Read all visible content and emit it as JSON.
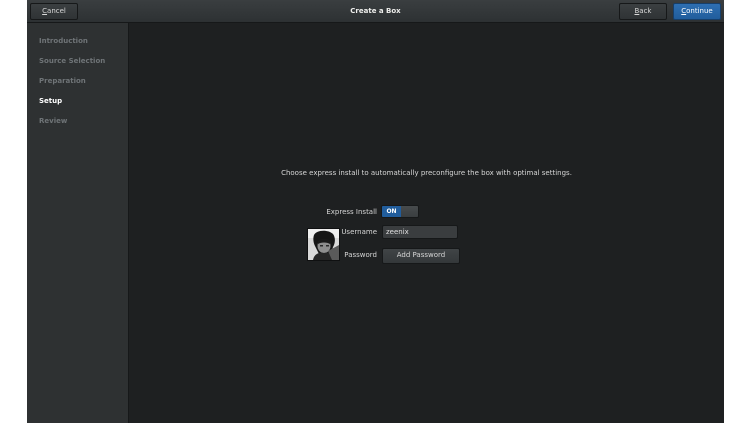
{
  "header": {
    "cancel_prefix": "C",
    "cancel_rest": "ancel",
    "title": "Create a Box",
    "back_prefix": "B",
    "back_rest": "ack",
    "continue_prefix": "C",
    "continue_rest": "ontinue"
  },
  "sidebar": {
    "steps": [
      {
        "label": "Introduction"
      },
      {
        "label": "Source Selection"
      },
      {
        "label": "Preparation"
      },
      {
        "label": "Setup",
        "active": true
      },
      {
        "label": "Review"
      }
    ]
  },
  "setup": {
    "hint": "Choose express install to automatically preconfigure the box with optimal settings.",
    "express_label": "Express Install",
    "express_state": "ON",
    "username_label": "Username",
    "username_value": "zeenix",
    "password_label": "Password",
    "add_password_label": "Add Password"
  },
  "colors": {
    "accent": "#215d9c",
    "background": "#1e2021",
    "sidebar": "#2e3132"
  },
  "icons": {
    "avatar": "user-avatar-icon"
  }
}
